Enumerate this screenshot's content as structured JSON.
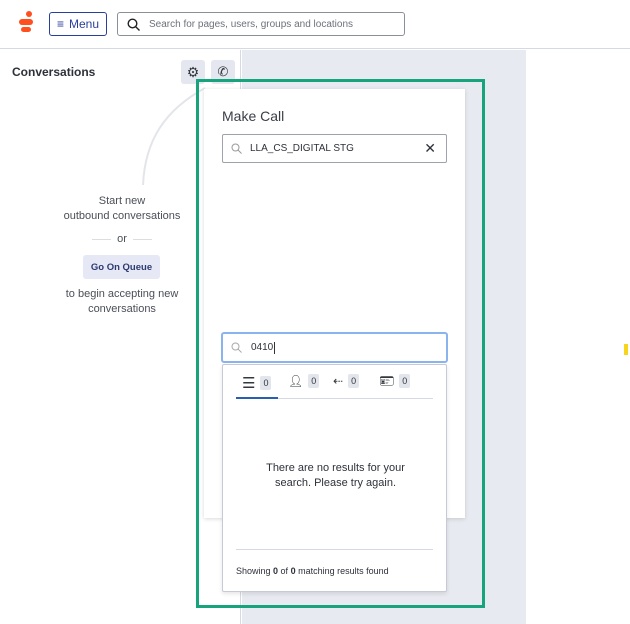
{
  "header": {
    "menu_label": "Menu",
    "search_placeholder": "Search for pages, users, groups and locations"
  },
  "sidebar": {
    "title": "Conversations",
    "start_line1": "Start new",
    "start_line2": "outbound conversations",
    "or": "or",
    "queue_button": "Go On Queue",
    "accept_line1": "to begin accepting new",
    "accept_line2": "conversations"
  },
  "make_call": {
    "title": "Make Call",
    "queue_value": "LLA_CS_DIGITAL STG",
    "number_value": "0410",
    "tabs": [
      {
        "icon": "list-icon",
        "count": "0"
      },
      {
        "icon": "person-icon",
        "count": "0"
      },
      {
        "icon": "queue-icon",
        "count": "0"
      },
      {
        "icon": "contact-card-icon",
        "count": "0"
      }
    ],
    "empty_line1": "There are no results for your",
    "empty_line2": "search. Please try again.",
    "footer_prefix": "Showing ",
    "footer_shown": "0",
    "footer_of": " of ",
    "footer_total": "0",
    "footer_suffix": " matching results found"
  },
  "colors": {
    "accent": "#2a3f9d",
    "highlight": "#17a47c",
    "brand": "#ff4f1f"
  }
}
